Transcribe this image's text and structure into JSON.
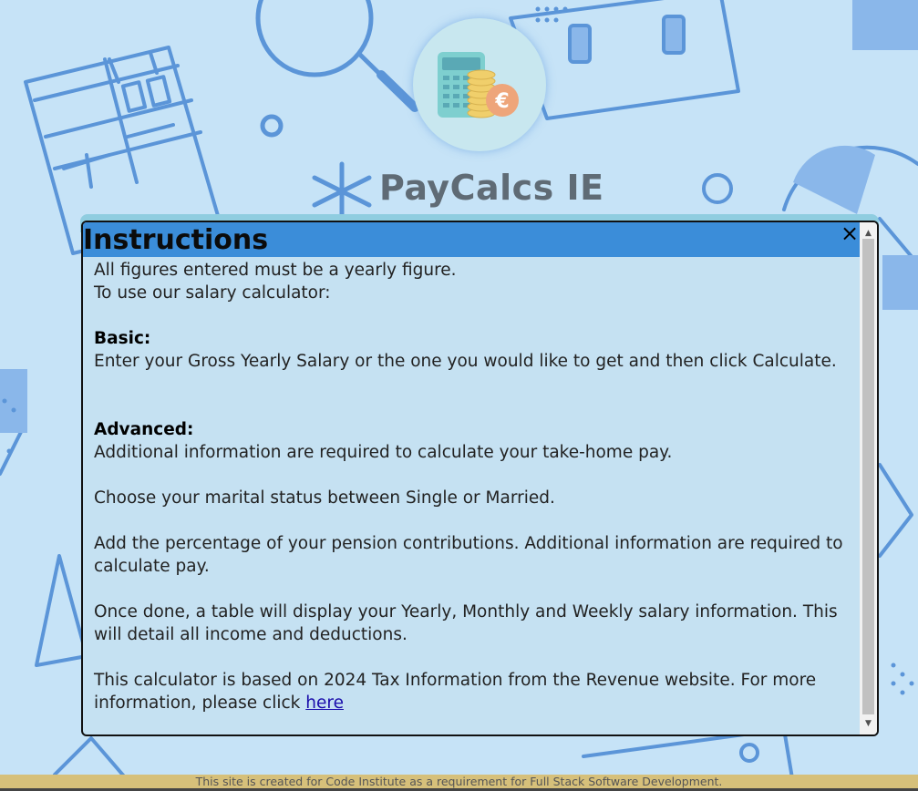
{
  "site": {
    "title": "PayCalcs IE",
    "logo_icon": "calculator-coins-euro-icon"
  },
  "modal": {
    "title": "Instructions",
    "close_icon": "×",
    "intro_1": "All figures entered must be a yearly figure.",
    "intro_2": "To use our salary calculator:",
    "basic_heading": "Basic:",
    "basic_text": "Enter your Gross Yearly Salary or the one you would like to get and then click Calculate.",
    "advanced_heading": "Advanced:",
    "advanced_text": "Additional information are required to calculate your take-home pay.",
    "marital_text": "Choose your marital status between Single or Married.",
    "pension_text": "Add the percentage of your pension contributions. Additional information are required to calculate pay.",
    "table_text": "Once done, a table will display your Yearly, Monthly and Weekly salary information. This will detail all income and deductions.",
    "revenue_text": "This calculator is based on 2024 Tax Information from the Revenue website. For more information, please click ",
    "link_text": "here",
    "scroll_up": "▲",
    "scroll_down": "▼"
  },
  "footer": {
    "text": "This site is created for Code Institute as a requirement for Full Stack Software Development."
  },
  "colors": {
    "background": "#c6e3f7",
    "header": "#3b8dd9",
    "modal_body": "#c5e1f2",
    "footer": "#d6c07a",
    "pattern": "#5b95d8"
  }
}
